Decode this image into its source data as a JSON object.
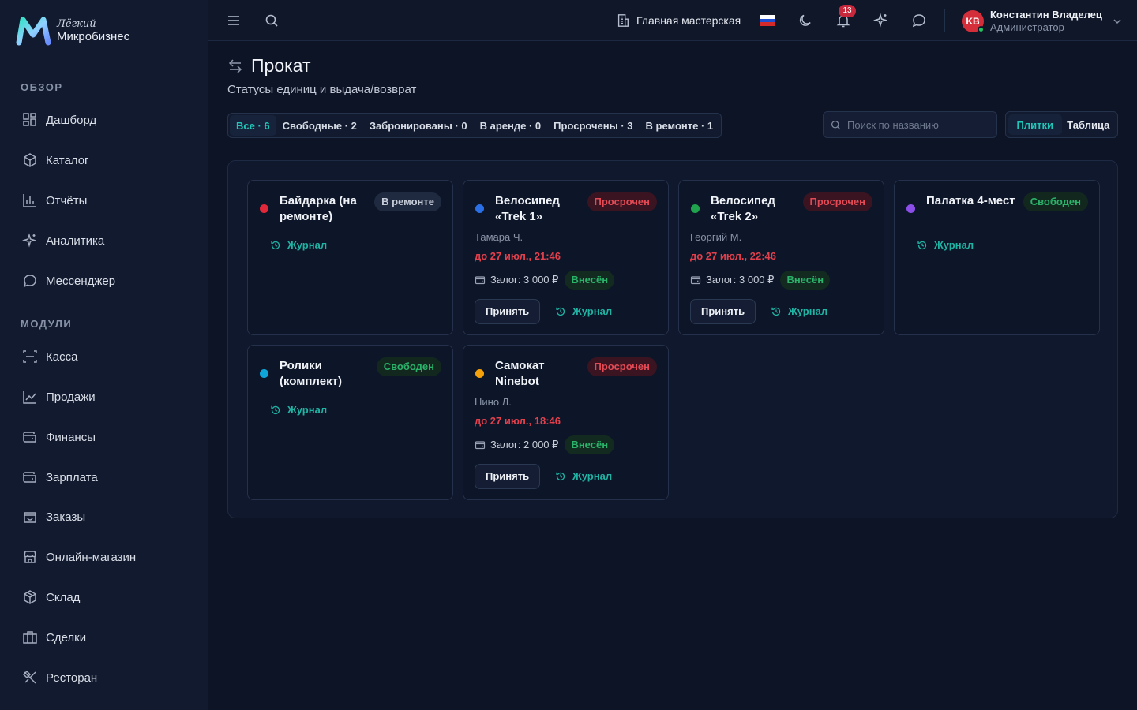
{
  "logo": {
    "top": "Лёгкий",
    "bottom": "Микробизнес"
  },
  "sidebar": {
    "sections": [
      {
        "label": "ОБЗОР"
      },
      {
        "label": "МОДУЛИ"
      }
    ],
    "items": [
      {
        "label": "Дашборд",
        "icon": "dashboard-icon"
      },
      {
        "label": "Каталог",
        "icon": "catalog-icon"
      },
      {
        "label": "Отчёты",
        "icon": "reports-icon"
      },
      {
        "label": "Аналитика",
        "icon": "sparkles-icon"
      },
      {
        "label": "Мессенджер",
        "icon": "chat-icon"
      },
      {
        "label": "Касса",
        "icon": "scan-icon"
      },
      {
        "label": "Продажи",
        "icon": "trend-icon"
      },
      {
        "label": "Финансы",
        "icon": "wallet-icon"
      },
      {
        "label": "Зарплата",
        "icon": "wallet-icon"
      },
      {
        "label": "Заказы",
        "icon": "bag-icon"
      },
      {
        "label": "Онлайн-магазин",
        "icon": "store-icon"
      },
      {
        "label": "Склад",
        "icon": "box-icon"
      },
      {
        "label": "Сделки",
        "icon": "briefcase-icon"
      },
      {
        "label": "Ресторан",
        "icon": "utensils-icon"
      }
    ]
  },
  "topbar": {
    "workshop": "Главная мастерская",
    "notifications_count": "13",
    "user": {
      "initials": "KB",
      "name": "Константин Владелец",
      "role": "Администратор"
    }
  },
  "page": {
    "title": "Прокат",
    "subtitle": "Статусы единиц и выдача/возврат"
  },
  "filters": [
    {
      "label": "Все · 6",
      "active": true
    },
    {
      "label": "Свободные · 2",
      "active": false
    },
    {
      "label": "Забронированы · 0",
      "active": false
    },
    {
      "label": "В аренде · 0",
      "active": false
    },
    {
      "label": "Просрочены · 3",
      "active": false
    },
    {
      "label": "В ремонте · 1",
      "active": false
    }
  ],
  "search": {
    "placeholder": "Поиск по названию",
    "value": ""
  },
  "view_toggle": {
    "tiles": "Плитки",
    "table": "Таблица"
  },
  "actions": {
    "accept": "Принять",
    "journal": "Журнал"
  },
  "colors": {
    "accent": "#1fc7b8",
    "overdue": "#e34a55",
    "free": "#2bb36a",
    "dot_red": "#e0283a",
    "dot_blue": "#2b6fe6",
    "dot_green": "#1fa34d",
    "dot_purple": "#8b4fe8",
    "dot_cyan": "#0ea5d8",
    "dot_orange": "#f5a10a"
  },
  "cards": [
    {
      "title": "Байдарка (на ремонте)",
      "status": "В ремонте",
      "status_type": "repair",
      "dot": "#e0283a"
    },
    {
      "title": "Велосипед «Trek 1»",
      "status": "Просрочен",
      "status_type": "overdue",
      "dot": "#2b6fe6",
      "person": "Тамара Ч.",
      "due": "до 27 июл., 21:46",
      "deposit": "Залог: 3 000 ₽",
      "deposit_status": "Внесён"
    },
    {
      "title": "Велосипед «Trek 2»",
      "status": "Просрочен",
      "status_type": "overdue",
      "dot": "#1fa34d",
      "person": "Георгий М.",
      "due": "до 27 июл., 22:46",
      "deposit": "Залог: 3 000 ₽",
      "deposit_status": "Внесён"
    },
    {
      "title": "Палатка 4-мест",
      "status": "Свободен",
      "status_type": "free",
      "dot": "#8b4fe8"
    },
    {
      "title": "Ролики (комплект)",
      "status": "Свободен",
      "status_type": "free",
      "dot": "#0ea5d8"
    },
    {
      "title": "Самокат Ninebot",
      "status": "Просрочен",
      "status_type": "overdue",
      "dot": "#f5a10a",
      "person": "Нино Л.",
      "due": "до 27 июл., 18:46",
      "deposit": "Залог: 2 000 ₽",
      "deposit_status": "Внесён"
    }
  ]
}
